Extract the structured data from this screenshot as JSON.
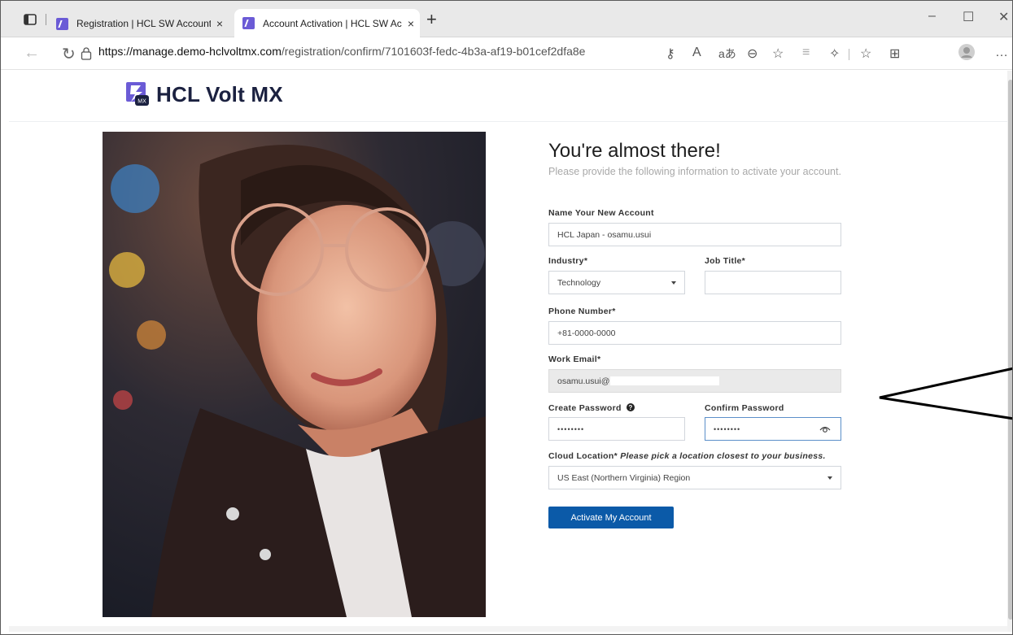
{
  "browser": {
    "tabs": [
      {
        "title": "Registration | HCL SW Accounts",
        "close": "×"
      },
      {
        "title": "Account Activation | HCL SW Acc",
        "close": "×"
      }
    ],
    "new_tab": "+",
    "window_controls": [
      "–",
      "☐",
      "✕"
    ],
    "url_host": "https://manage.demo-hclvoltmx.com",
    "url_path": "/registration/confirm/7101603f-fedc-4b3a-af19-b01cef2dfa8e",
    "read_aloud_label": "A",
    "translate_label": "aあ"
  },
  "brand": {
    "name": "HCL Volt MX",
    "logo_badge": "MX",
    "color": "#1b2140",
    "accent": "#6b5bd6"
  },
  "form": {
    "heading": "You're almost there!",
    "subtitle": "Please provide the following information to activate your account.",
    "account_name": {
      "label": "Name Your New Account",
      "value": "HCL Japan - osamu.usui"
    },
    "industry": {
      "label": "Industry*",
      "value": "Technology"
    },
    "job_title": {
      "label": "Job Title*",
      "value": ""
    },
    "phone": {
      "label": "Phone Number*",
      "value": "+81-0000-0000"
    },
    "email": {
      "label": "Work Email*",
      "value": "osamu.usui@"
    },
    "password": {
      "label": "Create Password",
      "value": "••••••••"
    },
    "confirm_password": {
      "label": "Confirm Password",
      "value": "••••••••"
    },
    "cloud_location": {
      "label": "Cloud Location*",
      "hint": "Please pick a location closest to your business.",
      "value": "US East (Northern Virginia) Region"
    },
    "submit_label": "Activate My Account",
    "submit_color": "#0b5aa8"
  }
}
